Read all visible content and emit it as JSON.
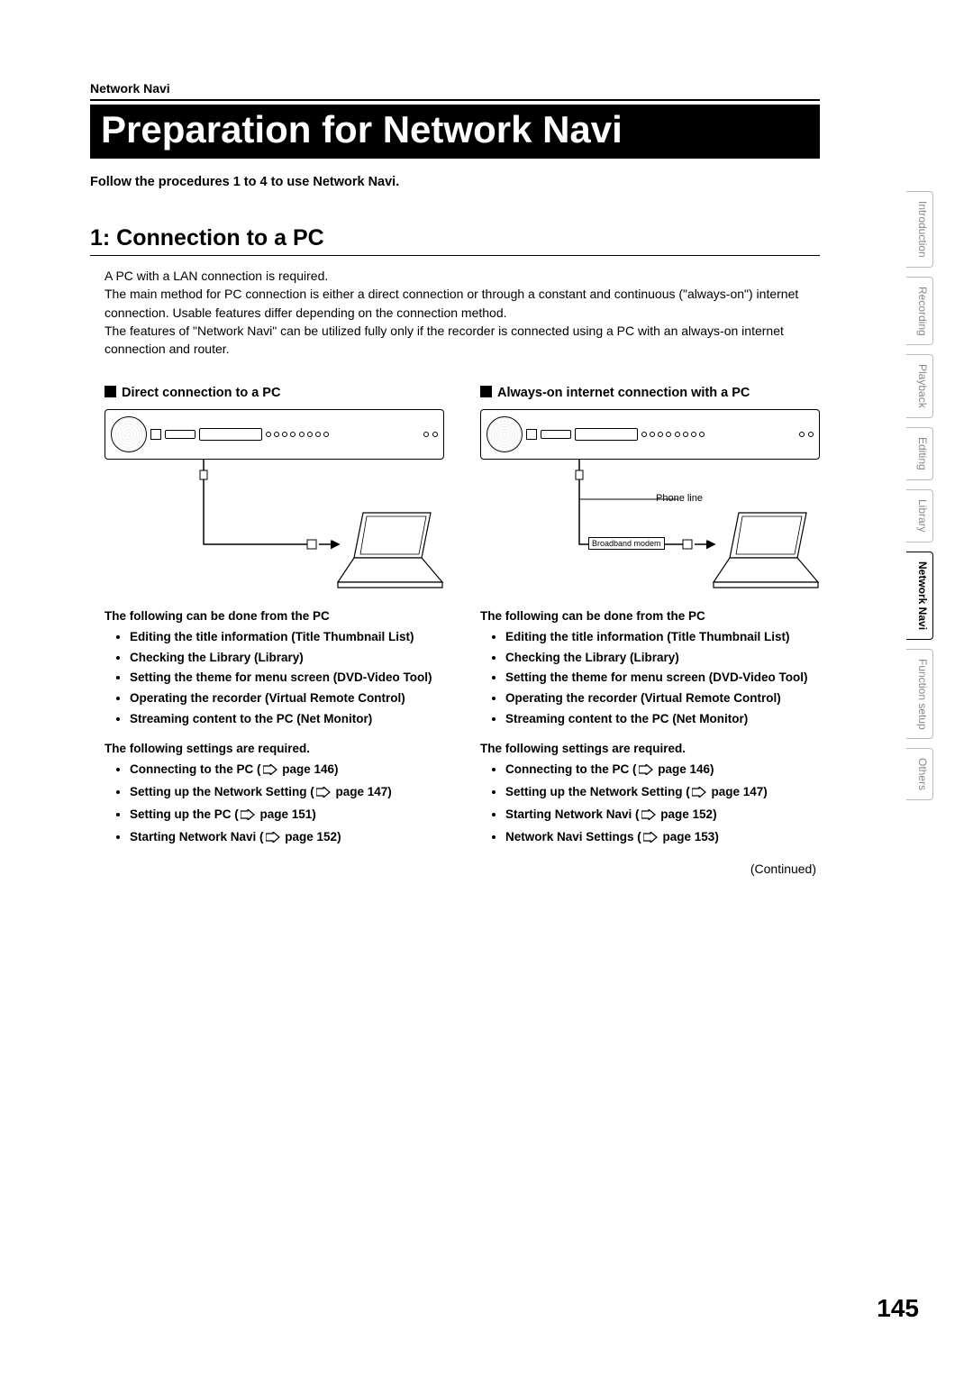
{
  "header": {
    "section_label": "Network Navi",
    "title": "Preparation for Network Navi",
    "intro_bold": "Follow the procedures 1 to 4 to use Network Navi."
  },
  "section1": {
    "heading": "1: Connection to a PC",
    "body": "A PC with a LAN connection is required.\nThe main method for PC connection is either a direct connection or through a constant and continuous (\"always-on\") internet connection. Usable features differ depending on the connection method.\nThe features of \"Network Navi\" can be utilized fully only if the recorder is connected using a PC with an always-on internet connection and router."
  },
  "left": {
    "subhead": "Direct connection to a PC",
    "features_head": "The following can be done from the PC",
    "features": [
      "Editing the title information (Title Thumbnail List)",
      "Checking the Library (Library)",
      "Setting the theme for menu screen (DVD-Video Tool)",
      "Operating the recorder (Virtual Remote Control)",
      "Streaming content to the PC (Net Monitor)"
    ],
    "settings_head": "The following settings are required.",
    "settings": [
      {
        "label": "Connecting to the PC (",
        "page": "page 146",
        "suffix": ")"
      },
      {
        "label": "Setting up the Network Setting (",
        "page": "page 147",
        "suffix": ")"
      },
      {
        "label": "Setting up the PC (",
        "page": "page 151",
        "suffix": ")"
      },
      {
        "label": "Starting Network Navi (",
        "page": "page 152",
        "suffix": ")"
      }
    ]
  },
  "right": {
    "subhead": "Always-on internet connection with a PC",
    "diagram": {
      "modem_label": "Broadband modem",
      "phone_label": "Phone line"
    },
    "features_head": "The following can be done from the PC",
    "features": [
      "Editing the title information (Title Thumbnail List)",
      "Checking the Library (Library)",
      "Setting the theme for menu screen (DVD-Video Tool)",
      "Operating the recorder (Virtual Remote Control)",
      "Streaming content to the PC (Net Monitor)"
    ],
    "settings_head": "The following settings are required.",
    "settings": [
      {
        "label": "Connecting to the PC (",
        "page": "page 146",
        "suffix": ")"
      },
      {
        "label": "Setting up the Network Setting (",
        "page": "page 147",
        "suffix": ")"
      },
      {
        "label": "Starting Network Navi (",
        "page": "page 152",
        "suffix": ")"
      },
      {
        "label": "Network Navi Settings (",
        "page": "page 153",
        "suffix": ")"
      }
    ]
  },
  "continued": "(Continued)",
  "tabs": [
    "Introduction",
    "Recording",
    "Playback",
    "Editing",
    "Library",
    "Network Navi",
    "Function setup",
    "Others"
  ],
  "active_tab_index": 5,
  "page_number": "145"
}
